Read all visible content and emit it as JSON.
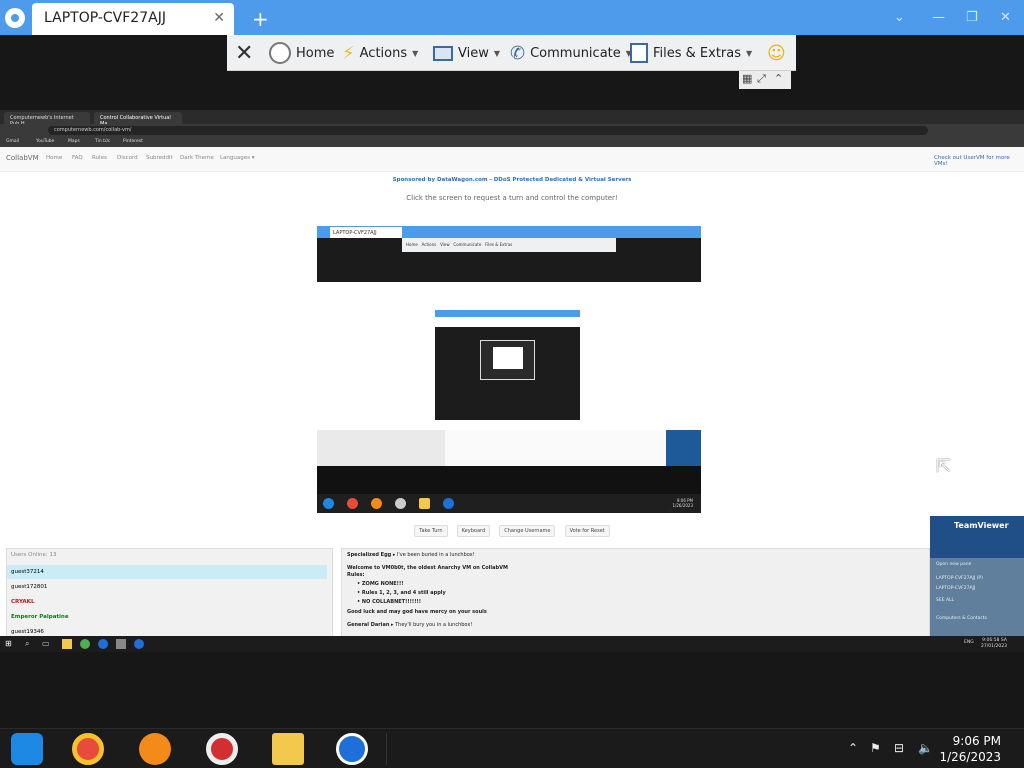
{
  "teamviewer": {
    "tab_title": "LAPTOP-CVF27AJJ",
    "new_tab": "+",
    "toolbar": {
      "home": "Home",
      "actions": "Actions",
      "view": "View",
      "communicate": "Communicate",
      "files_extras": "Files & Extras"
    }
  },
  "remote_browser": {
    "tabs": [
      "Computernewb's Internet Pub H...",
      "Control Collaborative Virtual Ma..."
    ],
    "url": "computernewb.com/collab-vm/",
    "bookmarks": [
      "Gmail",
      "YouTube",
      "Maps",
      "Tin tức",
      "Pinterest"
    ]
  },
  "site": {
    "brand": "CollabVM",
    "nav": [
      "Home",
      "FAQ",
      "Rules",
      "Discord",
      "Subreddit",
      "Dark Theme",
      "Languages ▾"
    ],
    "right_link": "Check out UserVM for more VMs!",
    "sponsor": "Sponsored by DataWagon.com - DDoS Protected Dedicated & Virtual Servers",
    "instruction": "Click the screen to request a turn and control the computer!",
    "vm_buttons": [
      "Take Turn",
      "Keyboard",
      "Change Username",
      "Vote for Reset"
    ]
  },
  "vm_screen": {
    "tab_title": "LAPTOP-CVF27AJJ",
    "clock_time": "9:06 PM",
    "clock_date": "1/26/2023"
  },
  "users": {
    "header": "Users Online: 13",
    "list": [
      {
        "name": "guest37214",
        "color": "#1d2c3b"
      },
      {
        "name": "guest172801",
        "color": "#333"
      },
      {
        "name": "CRYAKL",
        "color": "#c0161b"
      },
      {
        "name": "Emperor Palpatine",
        "color": "#0a7a14"
      },
      {
        "name": "guest19346",
        "color": "#333"
      }
    ]
  },
  "chat": {
    "messages": [
      {
        "user": "Specialized Egg",
        "text": "I've been buried in a lunchbox!"
      },
      {
        "user": "",
        "text": "Welcome to VM0b0t, the oldest Anarchy VM on CollabVM"
      },
      {
        "user": "",
        "text": "Rules:"
      },
      {
        "user": "",
        "text": "• ZOMG NONE!!!"
      },
      {
        "user": "",
        "text": "• Rules 1, 2, 3, and 4 still apply"
      },
      {
        "user": "",
        "text": "• NO COLLABNET!!!!!!!"
      },
      {
        "user": "",
        "text": "Good luck and may god have mercy on your souls"
      },
      {
        "user": "General Darian",
        "text": "They'll bury you in a lunchbox!"
      }
    ]
  },
  "teamviewer_panel": {
    "title": "TeamViewer",
    "items": [
      "Open new pane",
      "LAPTOP-CVF27AJJ (P)",
      "LAPTOP-CVF27AJJ",
      "SEE ALL",
      "Computers & Contacts"
    ]
  },
  "remote_taskbar": {
    "time": "9:06:58 SA",
    "date": "27/01/2023",
    "lang": "ENG"
  },
  "host_taskbar": {
    "time": "9:06 PM",
    "date": "1/26/2023"
  }
}
